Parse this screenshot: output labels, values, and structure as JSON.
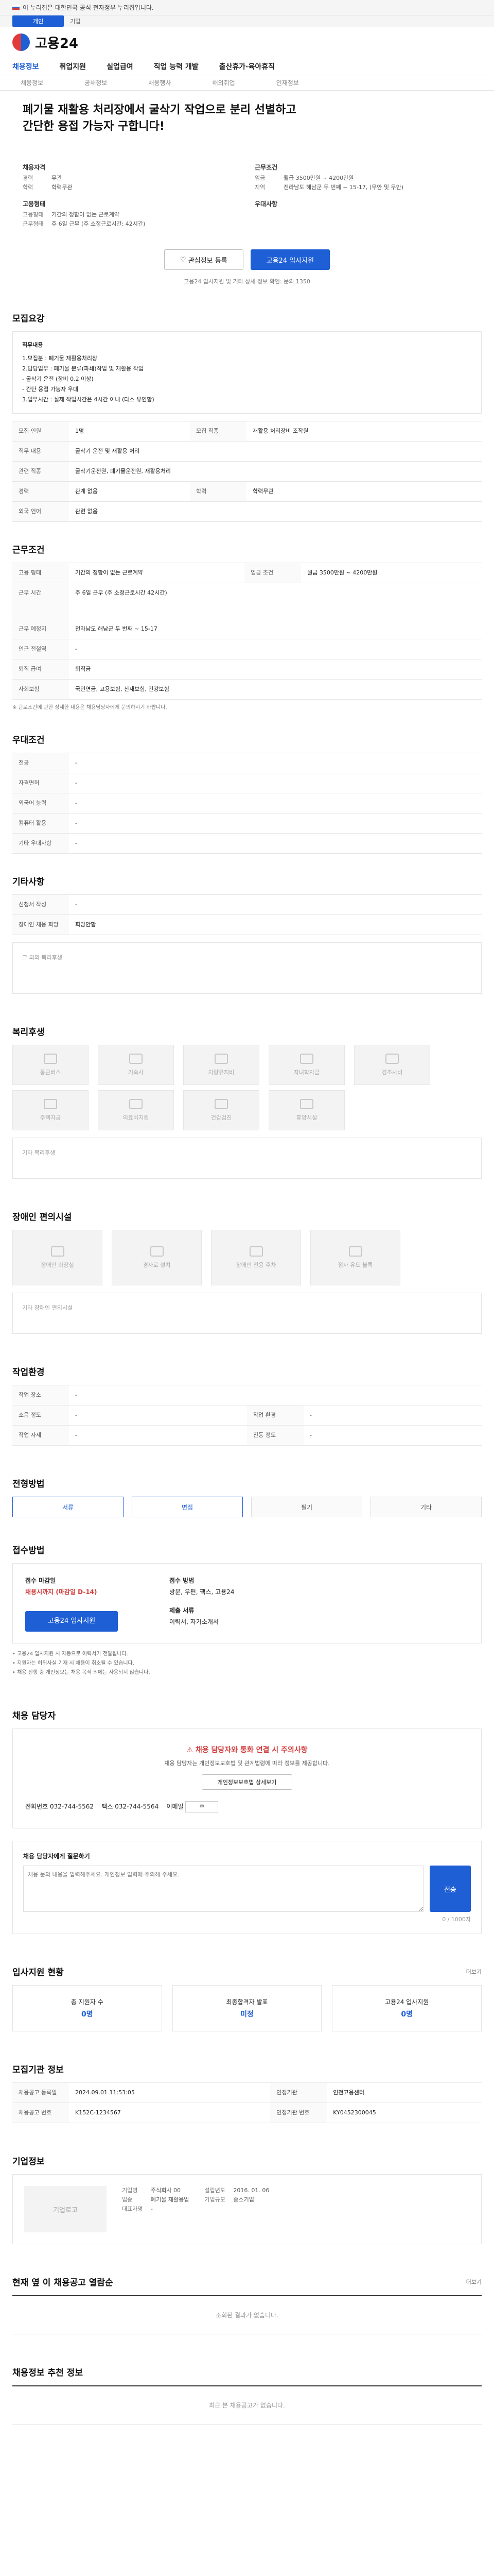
{
  "top_bar": {
    "text": "이 누리집은 대한민국 공식 전자정부 누리집입니다."
  },
  "top_links": {
    "selected": "개인",
    "other": "기업"
  },
  "logo": {
    "text": "고용24"
  },
  "gnb": [
    "채용정보",
    "취업지원",
    "실업급여",
    "직업 능력 개발",
    "출산휴가·육아휴직"
  ],
  "subnav": [
    "채용정보",
    "공채정보",
    "채용행사",
    "해외취업",
    "인재정보"
  ],
  "headline": "폐기물 재활용 처리장에서 굴삭기 작업으로 분리 선별하고 간단한 용접 가능자 구합니다!",
  "summary": {
    "left_h": "채용자격",
    "left": [
      [
        "경력",
        "무관"
      ],
      [
        "학력",
        "학력무관"
      ]
    ],
    "left_h2": "고용형태",
    "left2": [
      [
        "고용형태",
        "기간의 정함이 없는 근로계약"
      ],
      [
        "근무형태",
        "주 6일 근무 (주 소정근로시간: 42시간)"
      ]
    ],
    "right_h": "근무조건",
    "right": [
      [
        "임금",
        "월급 3500만원 ~ 4200만원"
      ],
      [
        "지역",
        "전라남도 해남군 두 번째 ~ 15-17, (무안 및 무안)"
      ]
    ],
    "right_h2": "우대사항"
  },
  "actions": {
    "favorite": "관심정보 등록",
    "apply": "고용24 입사지원"
  },
  "notice": "고용24 입사지원 및 기타 상세 정보 확인: 문의 1350",
  "detail": {
    "title": "모집요강",
    "duty_label": "직무내용",
    "duty": [
      "1.모집분 : 폐기물 재활용처리장",
      "2.담당업무 : 폐기물 분류(파쇄)작업 및 재활용 작업",
      "- 굴삭기 운전 (장비 0.2 이상)",
      "- 간단 용접 가능자 우대",
      "3.업무시간 : 실제 작업시간은 4시간 이내 (다소 유연함)"
    ],
    "rows": [
      [
        "모집 인원",
        "1명",
        "모집 직종",
        "재활용 처리장비 조작원"
      ],
      [
        "직무 내용",
        "굴삭기 운전 및 재활용 처리"
      ],
      [
        "관련 직종",
        "굴삭기운전원, 폐기물운전원, 재활용처리"
      ],
      [
        "경력",
        "관계 없음",
        "학력",
        "학력무관"
      ],
      [
        "외국 언어",
        "관련 없음"
      ]
    ]
  },
  "conditions": {
    "title": "근무조건",
    "rows": [
      [
        "고용 형태",
        "기간의 정함이 없는 근로계약",
        "임금 조건",
        "월급 3500만원 ~ 4200만원"
      ],
      [
        "근무 시간",
        "주 6일 근무 (주 소정근로시간 42시간)"
      ],
      [
        "근무 예정지",
        "전라남도 해남군 두 번째 ~ 15-17"
      ],
      [
        "인근 전철역",
        "-"
      ],
      [
        "퇴직 급여",
        "퇴직금"
      ],
      [
        "사회보험",
        "국민연금, 고용보험, 산재보험, 건강보험"
      ]
    ],
    "note": "※ 근로조건에 관한 상세한 내용은 채용담당자에게 문의하시기 바랍니다."
  },
  "preference": {
    "title": "우대조건",
    "rows": [
      [
        "전공",
        "-"
      ],
      [
        "자격면허",
        "-"
      ],
      [
        "외국어 능력",
        "-"
      ],
      [
        "컴퓨터 활용",
        "-"
      ],
      [
        "기타 우대사항",
        "-"
      ]
    ]
  },
  "etc": {
    "title": "기타사항",
    "rows": [
      [
        "신청서 작성",
        "-"
      ],
      [
        "장애인 채용 희망",
        "희망안함"
      ]
    ],
    "box_label": "그 외의 복리후생"
  },
  "welfare": {
    "title": "복리후생",
    "tiles1": [
      "통근버스",
      "기숙사",
      "차량유지비",
      "자녀학자금",
      "경조사비"
    ],
    "tiles2": [
      "주택자금",
      "의료비지원",
      "건강검진",
      "휴양시설"
    ],
    "box": "기타 복리후생"
  },
  "disability": {
    "title": "장애인 편의시설",
    "tiles": [
      "장애인 화장실",
      "경사로 설치",
      "장애인 전용 주차",
      "점자 유도 블록"
    ],
    "box": "기타 장애인 편의시설"
  },
  "env": {
    "title": "작업환경",
    "rows": [
      [
        "작업 장소",
        "-"
      ],
      [
        "소음 정도",
        "-",
        "작업 환경",
        "-"
      ],
      [
        "작업 자세",
        "-",
        "진동 정도",
        "-"
      ]
    ]
  },
  "process": {
    "title": "전형방법",
    "steps": [
      "서류",
      "면접",
      "필기",
      "기타"
    ]
  },
  "apply": {
    "title": "접수방법",
    "deadline_label": "접수 마감일",
    "deadline": "채용시까지 (마감일 D-14)",
    "method_label": "접수 방법",
    "method": "방문, 우편, 팩스, 고용24",
    "docs_label": "제출 서류",
    "docs": "이력서, 자기소개서",
    "button": "고용24 입사지원",
    "bullets": [
      "고용24 입사지원 시 자동으로 이력서가 전달됩니다.",
      "지원자는 허위사실 기재 시 채용이 취소될 수 있습니다.",
      "채용 진행 중 개인정보는 채용 목적 외에는 사용되지 않습니다."
    ]
  },
  "contact": {
    "title": "채용 담당자",
    "warn": "채용 담당자와 통화 연결 시 주의사항",
    "desc": "채용 담당자는 개인정보보호법 및 관계법령에 따라 정보를 제공합니다.",
    "btn": "개인정보보호법 상세보기",
    "phone_label": "전화번호",
    "phone": "032-744-5562",
    "fax_label": "팩스",
    "fax": "032-744-5564",
    "email_label": "이메일"
  },
  "ask": {
    "title": "채용 담당자에게 질문하기",
    "placeholder": "채용 문의 내용을 입력해주세요. 개인정보 입력에 주의해 주세요.",
    "counter": "0 / 1000자",
    "submit": "전송"
  },
  "inform": {
    "title": "입사지원 현황",
    "cards": [
      [
        "총 지원자 수",
        "0명"
      ],
      [
        "최종합격자 발표",
        "미정"
      ],
      [
        "고용24 입사지원",
        "0명"
      ]
    ]
  },
  "admin": {
    "title": "모집기관 정보",
    "rows": [
      [
        "채용공고 등록일",
        "2024.09.01 11:53:05",
        "인정기관",
        "인천고용센터"
      ],
      [
        "채용공고 번호",
        "K152C-1234567",
        "인정기관 번호",
        "KY0452300045"
      ]
    ]
  },
  "company": {
    "title": "기업정보",
    "logo": "기업로고",
    "rows": [
      [
        "기업명",
        "주식회사 00"
      ],
      [
        "업종",
        "폐기물 재활용업"
      ],
      [
        "대표자명",
        "-"
      ],
      [
        "설립년도",
        "2016. 01. 06"
      ],
      [
        "기업규모",
        "중소기업"
      ]
    ]
  },
  "sameclass": {
    "title": "현재 옆 이 채용공고 열람순",
    "empty": "조회된 결과가 없습니다."
  },
  "recent": {
    "title": "채용정보 추천 정보",
    "empty": "최근 본 채용공고가 없습니다."
  },
  "more_label": "더보기"
}
